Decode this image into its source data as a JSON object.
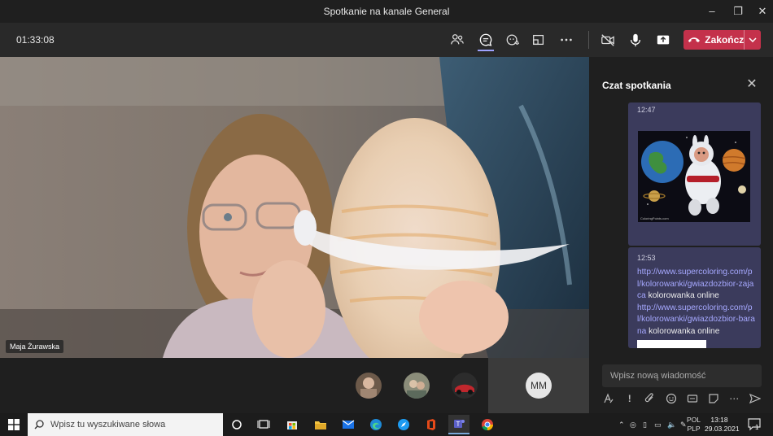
{
  "window": {
    "title": "Spotkanie na kanale General"
  },
  "toolbar": {
    "timer": "01:33:08",
    "end_label": "Zakończ"
  },
  "video": {
    "participant_name": "Maja Żurawska"
  },
  "strip": {
    "mm_initials": "MM"
  },
  "chat": {
    "title": "Czat spotkania",
    "messages": [
      {
        "time": "12:47",
        "image_caption": "ColoringPoints.com"
      },
      {
        "time": "12:53",
        "link1": "http://www.supercoloring.com/pl/kolorowanki/gwiazdozbior-zajaca",
        "text1": " kolorowanka online",
        "link2": "http://www.supercoloring.com/pl/kolorowanki/gwiazdozbior-barana",
        "text2": " kolorowanka online"
      }
    ],
    "compose_placeholder": "Wpisz nową wiadomość"
  },
  "taskbar": {
    "search_placeholder": "Wpisz tu wyszukiwane słowa",
    "lang_top": "POL",
    "lang_bottom": "PLP",
    "time": "13:18",
    "date": "29.03.2021",
    "notif_count": "1"
  },
  "colors": {
    "end_button": "#c4314b",
    "accent": "#9ea2ff",
    "message_bubble": "#3b3b5c"
  }
}
